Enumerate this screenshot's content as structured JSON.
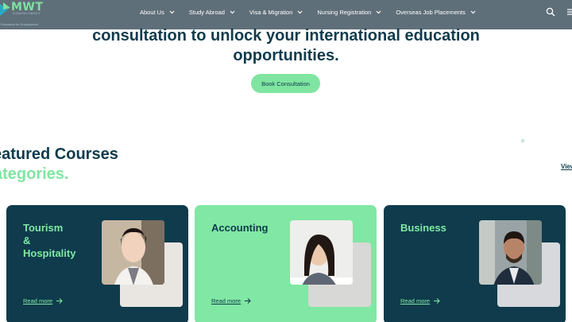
{
  "header": {
    "logo_text": "MWT",
    "logo_sub": "CONSULTANCY",
    "logo_tagline": "Education for Employment",
    "nav": [
      {
        "label": "About Us"
      },
      {
        "label": "Study Abroad"
      },
      {
        "label": "Visa & Migration"
      },
      {
        "label": "Nursing Registration"
      },
      {
        "label": "Overseas Job Placements"
      }
    ]
  },
  "hero": {
    "title_line1": "consultation to unlock your international education",
    "title_line2": "opportunities.",
    "cta_label": "Book Consultation"
  },
  "courses": {
    "title_line1": "eatured Courses",
    "title_line2": "ategories.",
    "view_all": "View",
    "cards": [
      {
        "title_lines": [
          "Tourism",
          "&",
          "Hospitality"
        ],
        "read_more": "Read more",
        "theme": "dark"
      },
      {
        "title_lines": [
          "Accounting"
        ],
        "read_more": "Read more",
        "theme": "light"
      },
      {
        "title_lines": [
          "Business"
        ],
        "read_more": "Read more",
        "theme": "dark"
      }
    ]
  },
  "colors": {
    "header_bg": "#5f6f7a",
    "navy": "#0f3b4c",
    "mint": "#80e7a4"
  },
  "icons": {
    "search": "search-icon",
    "menu": "menu-icon",
    "chevron": "chevron-down-icon",
    "arrow": "arrow-right-icon"
  }
}
